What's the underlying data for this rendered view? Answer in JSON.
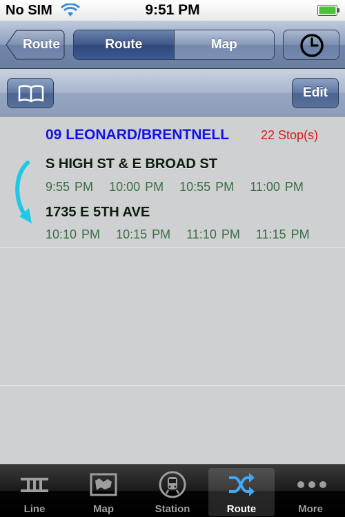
{
  "status_bar": {
    "carrier": "No SIM",
    "time": "9:51 PM"
  },
  "nav": {
    "back_label": "Route",
    "segments": [
      "Route",
      "Map"
    ],
    "active_segment": "Route",
    "clock_icon": "clock-icon"
  },
  "toolbar": {
    "book_icon": "book-icon",
    "edit_label": "Edit"
  },
  "route": {
    "name": "09 LEONARD/BRENTNELL",
    "stops_count": "22 Stop(s)",
    "from": {
      "name": "S HIGH ST & E BROAD ST",
      "times": [
        "9:55 PM",
        "10:00 PM",
        "10:55 PM",
        "11:00 PM"
      ]
    },
    "to": {
      "name": "1735 E 5TH AVE",
      "times": [
        "10:10 PM",
        "10:15 PM",
        "11:10 PM",
        "11:15 PM"
      ]
    }
  },
  "tabs": [
    {
      "label": "Line",
      "icon": "rail-track-icon"
    },
    {
      "label": "Map",
      "icon": "map-icon"
    },
    {
      "label": "Station",
      "icon": "train-icon"
    },
    {
      "label": "Route",
      "icon": "shuffle-icon",
      "selected": true
    },
    {
      "label": "More",
      "icon": "more-icon"
    }
  ],
  "colors": {
    "route_name": "#1212e6",
    "stops": "#d41d16",
    "times": "#3b6d45",
    "arrow": "#1ec8e6"
  }
}
